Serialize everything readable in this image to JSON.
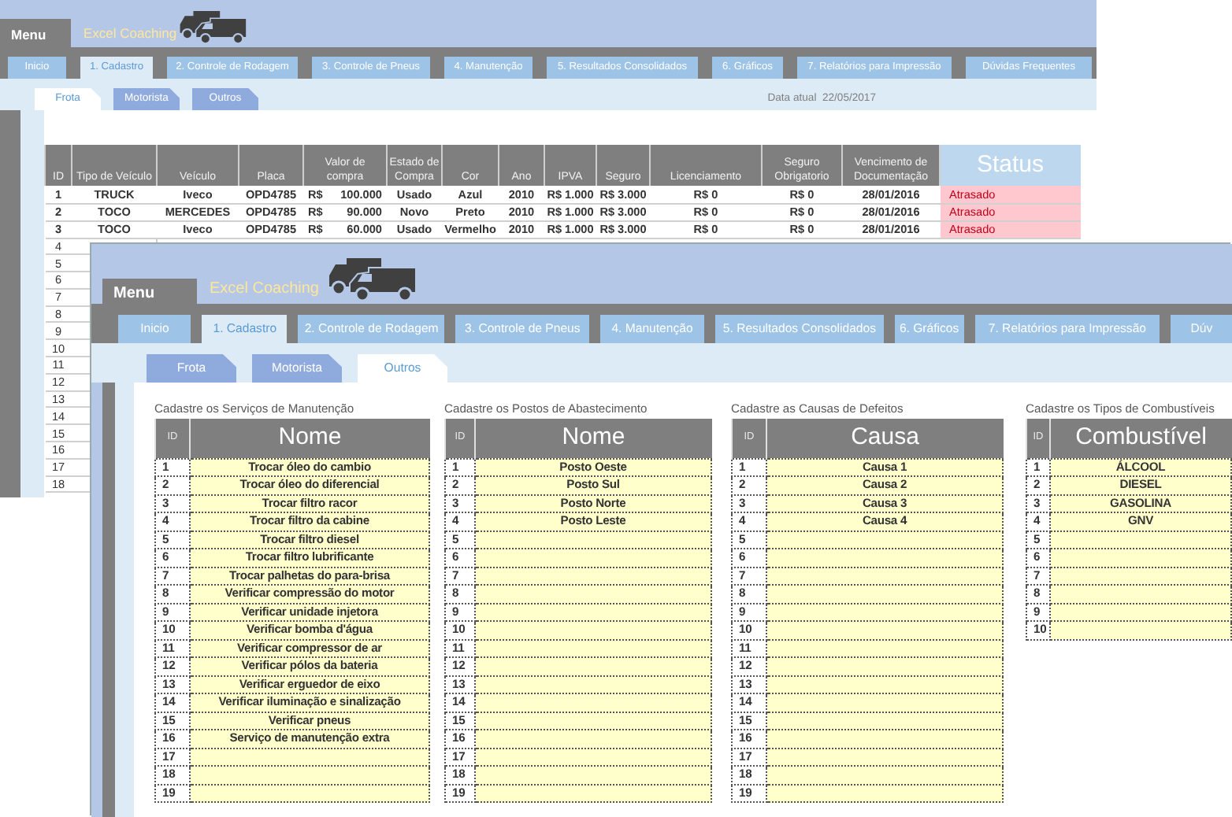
{
  "back_window": {
    "menu_label": "Menu",
    "brand": "Excel Coaching",
    "tabs": [
      {
        "label": "Inicio",
        "selected": false
      },
      {
        "label": "1. Cadastro",
        "selected": true
      },
      {
        "label": "2. Controle de Rodagem",
        "selected": false
      },
      {
        "label": "3. Controle de Pneus",
        "selected": false
      },
      {
        "label": "4. Manutenção",
        "selected": false
      },
      {
        "label": "5. Resultados Consolidados",
        "selected": false
      },
      {
        "label": "6. Gráficos",
        "selected": false
      },
      {
        "label": "7.  Relatórios para Impressão",
        "selected": false
      },
      {
        "label": "Dúvidas Frequentes",
        "selected": false
      }
    ],
    "subtabs": [
      {
        "label": "Frota",
        "selected": true
      },
      {
        "label": "Motorista",
        "selected": false
      },
      {
        "label": "Outros",
        "selected": false
      }
    ],
    "current_date": "Data atual  22/05/2017",
    "fleet_table": {
      "columns": [
        {
          "label": "ID",
          "kind": "plain"
        },
        {
          "label": "Tipo de Veículo",
          "kind": "plain"
        },
        {
          "label": "Veículo",
          "kind": "plain"
        },
        {
          "label": "Placa",
          "kind": "plain"
        },
        {
          "label": "Valor de compra",
          "kind": "plain"
        },
        {
          "label": "Estado de Compra",
          "kind": "plain"
        },
        {
          "label": "Cor",
          "kind": "plain"
        },
        {
          "label": "Ano",
          "kind": "plain"
        },
        {
          "label": "IPVA",
          "kind": "plain"
        },
        {
          "label": "Seguro",
          "kind": "plain"
        },
        {
          "label": "Licenciamento",
          "kind": "plain"
        },
        {
          "label": "Seguro Obrigatorio",
          "kind": "plain"
        },
        {
          "label": "Vencimento de Documentação",
          "kind": "plain"
        },
        {
          "label": "Status",
          "kind": "highlight"
        }
      ],
      "rows": [
        {
          "id": "1",
          "type": "TRUCK",
          "vehicle": "Iveco",
          "plate": "OPD4785",
          "price_currency": "R$",
          "price": "100.000",
          "condition": "Usado",
          "color_name": "Azul",
          "year": "2010",
          "ipva": "R$ 1.000",
          "insurance": "R$ 3.000",
          "licensing": "R$ 0",
          "mandatory_insurance": "R$ 0",
          "doc_due": "28/01/2016",
          "status": "Atrasado",
          "overdue": true
        },
        {
          "id": "2",
          "type": "TOCO",
          "vehicle": "MERCEDES",
          "plate": "OPD4785",
          "price_currency": "R$",
          "price": "90.000",
          "condition": "Novo",
          "color_name": "Preto",
          "year": "2010",
          "ipva": "R$ 1.000",
          "insurance": "R$ 3.000",
          "licensing": "R$ 0",
          "mandatory_insurance": "R$ 0",
          "doc_due": "28/01/2016",
          "status": "Atrasado",
          "overdue": true
        },
        {
          "id": "3",
          "type": "TOCO",
          "vehicle": "Iveco",
          "plate": "OPD4785",
          "price_currency": "R$",
          "price": "60.000",
          "condition": "Usado",
          "color_name": "Vermelho",
          "year": "2010",
          "ipva": "R$ 1.000",
          "insurance": "R$ 3.000",
          "licensing": "R$ 0",
          "mandatory_insurance": "R$ 0",
          "doc_due": "28/01/2016",
          "status": "Atrasado",
          "overdue": true
        }
      ],
      "empty_row_ids": [
        "4",
        "5",
        "6",
        "7",
        "8",
        "9",
        "10",
        "11",
        "12",
        "13",
        "14",
        "15",
        "16",
        "17",
        "18"
      ]
    }
  },
  "front_window": {
    "menu_label": "Menu",
    "brand": "Excel Coaching",
    "tabs": [
      {
        "label": "Inicio",
        "selected": false
      },
      {
        "label": "1. Cadastro",
        "selected": true
      },
      {
        "label": "2. Controle de Rodagem",
        "selected": false
      },
      {
        "label": "3. Controle de Pneus",
        "selected": false
      },
      {
        "label": "4. Manutenção",
        "selected": false
      },
      {
        "label": "5. Resultados Consolidados",
        "selected": false
      },
      {
        "label": "6. Gráficos",
        "selected": false
      },
      {
        "label": "7.  Relatórios para Impressão",
        "selected": false
      },
      {
        "label": "Dúv",
        "selected": false
      }
    ],
    "subtabs": [
      {
        "label": "Frota",
        "selected": false
      },
      {
        "label": "Motorista",
        "selected": false
      },
      {
        "label": "Outros",
        "selected": true
      }
    ],
    "tables": [
      {
        "title": "Cadastre os Serviços de Manutenção",
        "id_header": "ID",
        "name_header": "Nome",
        "rows": [
          {
            "id": "1",
            "name": "Trocar óleo do cambio"
          },
          {
            "id": "2",
            "name": "Trocar óleo do diferencial"
          },
          {
            "id": "3",
            "name": "Trocar filtro racor"
          },
          {
            "id": "4",
            "name": "Trocar filtro da cabine"
          },
          {
            "id": "5",
            "name": "Trocar filtro diesel"
          },
          {
            "id": "6",
            "name": "Trocar filtro lubrificante"
          },
          {
            "id": "7",
            "name": "Trocar palhetas do para-brisa"
          },
          {
            "id": "8",
            "name": "Verificar compressão do motor"
          },
          {
            "id": "9",
            "name": "Verificar unidade injetora"
          },
          {
            "id": "10",
            "name": "Verificar bomba d'água"
          },
          {
            "id": "11",
            "name": "Verificar compressor de ar"
          },
          {
            "id": "12",
            "name": "Verificar pólos da bateria"
          },
          {
            "id": "13",
            "name": "Verificar erguedor de eixo"
          },
          {
            "id": "14",
            "name": "Verificar iluminação e sinalização"
          },
          {
            "id": "15",
            "name": "Verificar pneus"
          },
          {
            "id": "16",
            "name": "Serviço de manutenção extra"
          },
          {
            "id": "17"
          },
          {
            "id": "18"
          },
          {
            "id": "19"
          }
        ]
      },
      {
        "title": "Cadastre os Postos de Abastecimento",
        "id_header": "ID",
        "name_header": "Nome",
        "rows": [
          {
            "id": "1",
            "name": "Posto Oeste"
          },
          {
            "id": "2",
            "name": "Posto Sul"
          },
          {
            "id": "3",
            "name": "Posto Norte"
          },
          {
            "id": "4",
            "name": "Posto Leste"
          },
          {
            "id": "5"
          },
          {
            "id": "6"
          },
          {
            "id": "7"
          },
          {
            "id": "8"
          },
          {
            "id": "9"
          },
          {
            "id": "10"
          },
          {
            "id": "11"
          },
          {
            "id": "12"
          },
          {
            "id": "13"
          },
          {
            "id": "14"
          },
          {
            "id": "15"
          },
          {
            "id": "16"
          },
          {
            "id": "17"
          },
          {
            "id": "18"
          },
          {
            "id": "19"
          }
        ]
      },
      {
        "title": "Cadastre as Causas de Defeitos",
        "id_header": "ID",
        "name_header": "Causa",
        "rows": [
          {
            "id": "1",
            "name": "Causa 1"
          },
          {
            "id": "2",
            "name": "Causa 2"
          },
          {
            "id": "3",
            "name": "Causa 3"
          },
          {
            "id": "4",
            "name": "Causa 4"
          },
          {
            "id": "5"
          },
          {
            "id": "6"
          },
          {
            "id": "7"
          },
          {
            "id": "8"
          },
          {
            "id": "9"
          },
          {
            "id": "10"
          },
          {
            "id": "11"
          },
          {
            "id": "12"
          },
          {
            "id": "13"
          },
          {
            "id": "14"
          },
          {
            "id": "15"
          },
          {
            "id": "16"
          },
          {
            "id": "17"
          },
          {
            "id": "18"
          },
          {
            "id": "19"
          }
        ]
      },
      {
        "title": "Cadastre os Tipos de Combustíveis",
        "id_header": "ID",
        "name_header": "Combustível",
        "rows": [
          {
            "id": "1",
            "name": "ÁLCOOL"
          },
          {
            "id": "2",
            "name": "DIESEL"
          },
          {
            "id": "3",
            "name": "GASOLINA"
          },
          {
            "id": "4",
            "name": "GNV"
          },
          {
            "id": "5"
          },
          {
            "id": "6"
          },
          {
            "id": "7"
          },
          {
            "id": "8"
          },
          {
            "id": "9"
          },
          {
            "id": "10"
          }
        ]
      }
    ]
  }
}
